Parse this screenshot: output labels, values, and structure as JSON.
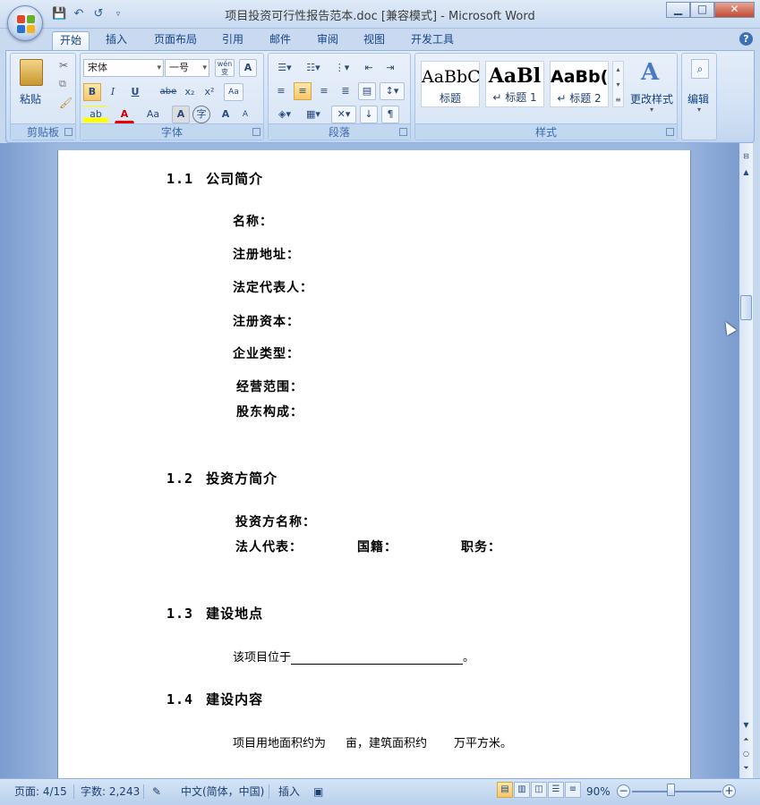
{
  "window": {
    "title": "项目投资可行性报告范本.doc [兼容模式] - Microsoft Word",
    "controls": {
      "minimize": "▁",
      "maximize": "□",
      "close": "✕"
    }
  },
  "quick_access": {
    "save_icon": "save-icon",
    "undo_icon": "undo-icon",
    "redo_icon": "redo-icon"
  },
  "tabs": [
    "开始",
    "插入",
    "页面布局",
    "引用",
    "邮件",
    "审阅",
    "视图",
    "开发工具"
  ],
  "active_tab": "开始",
  "ribbon": {
    "clipboard": {
      "label": "剪贴板",
      "paste": "粘贴"
    },
    "font": {
      "label": "字体",
      "font_name": "宋体",
      "font_size": "一号",
      "wen": "wén\n变",
      "a_box": "A",
      "bold": "B",
      "italic": "I",
      "underline": "U",
      "strike": "abe",
      "sub": "x₂",
      "sup": "x²",
      "clear": "Aa",
      "grow": "A",
      "shrink": "A",
      "case": "Aa"
    },
    "paragraph": {
      "label": "段落"
    },
    "styles": {
      "label": "样式",
      "items": [
        {
          "sample": "AaBbC",
          "name": "标题"
        },
        {
          "sample": "AaBl",
          "name": "↵ 标题 1"
        },
        {
          "sample": "AaBb(",
          "name": "↵ 标题 2"
        }
      ],
      "change_styles": "更改样式"
    },
    "editing": {
      "label": "编辑"
    }
  },
  "document": {
    "sections": [
      {
        "num": "1.1",
        "title": "公司简介"
      },
      {
        "num": "1.2",
        "title": "投资方简介"
      },
      {
        "num": "1.3",
        "title": "建设地点"
      },
      {
        "num": "1.4",
        "title": "建设内容"
      }
    ],
    "company_fields": [
      "名称：",
      "注册地址：",
      "法定代表人：",
      "注册资本：",
      "企业类型：",
      "经营范围：",
      "股东构成："
    ],
    "investor": {
      "name_label": "投资方名称：",
      "rep_label": "法人代表：",
      "nationality_label": "国籍：",
      "position_label": "职务："
    },
    "location": {
      "prefix": "该项目位于",
      "suffix": "。"
    },
    "content": {
      "text1": "项目用地面积约为",
      "text2": "亩，建筑面积约",
      "text3": "万平方米。"
    }
  },
  "status": {
    "page": "页面: 4/15",
    "words": "字数: 2,243",
    "language": "中文(简体，中国)",
    "mode": "插入",
    "zoom": "90%"
  }
}
